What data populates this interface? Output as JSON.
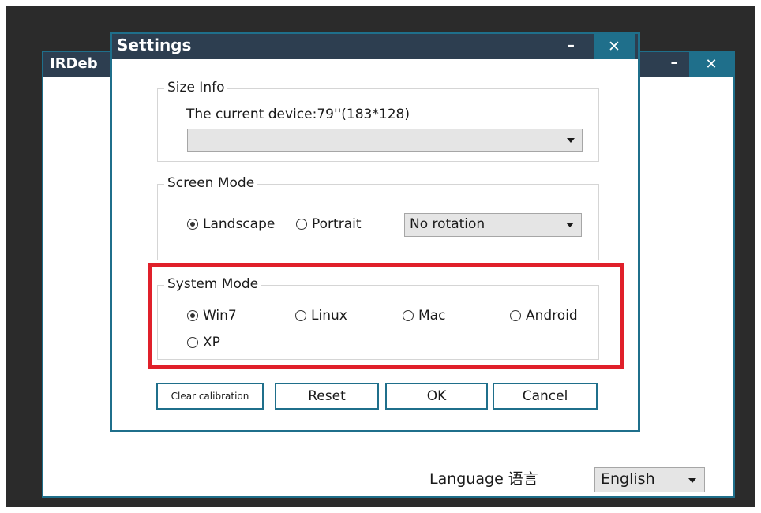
{
  "main_window": {
    "title": "IRDeb",
    "minimize_label": "–",
    "close_label": "✕",
    "language_label": "Language 语言",
    "language_value": "English"
  },
  "settings": {
    "title": "Settings",
    "minimize_label": "–",
    "close_label": "✕",
    "size_info": {
      "legend": "Size Info",
      "device_text": "The current device:79''(183*128)",
      "dropdown_value": ""
    },
    "screen_mode": {
      "legend": "Screen Mode",
      "options": [
        {
          "label": "Landscape",
          "selected": true
        },
        {
          "label": "Portrait",
          "selected": false
        }
      ],
      "rotation_value": "No rotation"
    },
    "system_mode": {
      "legend": "System Mode",
      "options": [
        {
          "label": "Win7",
          "selected": true
        },
        {
          "label": "Linux",
          "selected": false
        },
        {
          "label": "Mac",
          "selected": false
        },
        {
          "label": "Android",
          "selected": false
        },
        {
          "label": "XP",
          "selected": false
        }
      ]
    },
    "buttons": {
      "clear_calibration": "Clear calibration",
      "reset": "Reset",
      "ok": "OK",
      "cancel": "Cancel"
    }
  },
  "colors": {
    "titlebar": "#2d3e50",
    "accent": "#1f6f8b",
    "highlight": "#e0202a"
  }
}
